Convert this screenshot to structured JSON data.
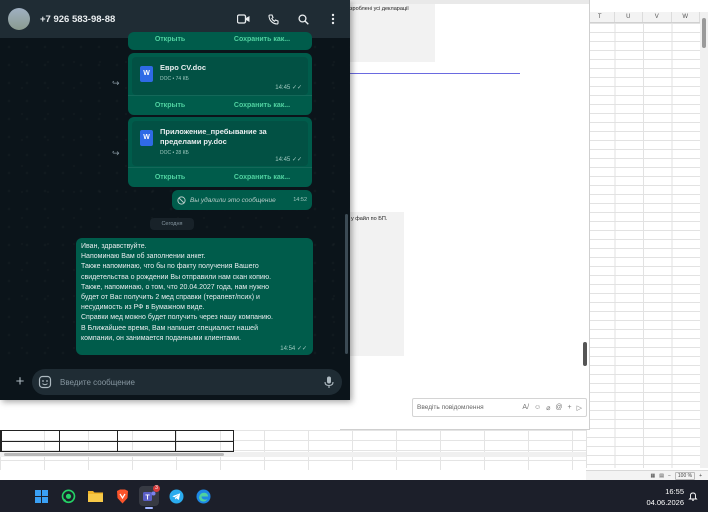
{
  "spreadsheet": {
    "columns": [
      "T",
      "U",
      "V",
      "W"
    ],
    "status": {
      "zoom": "100 %"
    }
  },
  "background_chat": {
    "bubble_top_text": "зроблені усі декларації",
    "bubble_mid_text": "у файл по БП.",
    "input_placeholder": "Введіть повідомлення"
  },
  "whatsapp": {
    "contact": "+7 926 583-98-88",
    "header_icons": [
      "video-call-icon",
      "voice-call-icon",
      "search-icon",
      "more-icon"
    ],
    "top_actions": {
      "open": "Открыть",
      "save": "Сохранить как..."
    },
    "docs": [
      {
        "name": "Евро CV.doc",
        "meta": "DOC • 74 КБ",
        "time": "14:45",
        "open": "Открыть",
        "save": "Сохранить как..."
      },
      {
        "name": "Приложение_пребывание за пределами ру.doc",
        "meta": "DOC • 28 КБ",
        "time": "14:45",
        "open": "Открыть",
        "save": "Сохранить как..."
      }
    ],
    "deleted": {
      "text": "Вы удалили это сообщение",
      "time": "14:52"
    },
    "date_divider": "Сегодня",
    "message": {
      "lines": [
        "Иван, здравствуйте.",
        "Напоминаю Вам об заполнении анкет.",
        "Также напоминаю, что бы по факту получения Вашего",
        "свидетельства о рождении Вы отправили нам скан копию.",
        "Также, напоминаю, о том, что 20.04.2027 года, нам нужно",
        "будет от Вас получить 2 мед справки (терапевт/псих) и",
        "несудимость из РФ в Бумажном виде.",
        "Справки мед можно будет получить через нашу компанию.",
        "В Ближайшее время, Вам напишет специалист нашей",
        "компании, он занимается поданными клиентами."
      ],
      "time": "14:54"
    },
    "input_placeholder": "Введите сообщение",
    "input_value": ""
  },
  "taskbar": {
    "apps": [
      "windows-start-icon",
      "whatsapp-icon",
      "file-explorer-icon",
      "brave-browser-icon",
      "teams-icon",
      "telegram-icon",
      "edge-icon"
    ],
    "badge": "3",
    "time": "16:55",
    "date": "04.06.2026"
  },
  "colors": {
    "wa_bg": "#0b141a",
    "wa_header": "#1f2c34",
    "wa_bubble_out": "#005c4b",
    "wa_accent": "#4fd1a0",
    "taskbar": "#1c1f2a"
  }
}
